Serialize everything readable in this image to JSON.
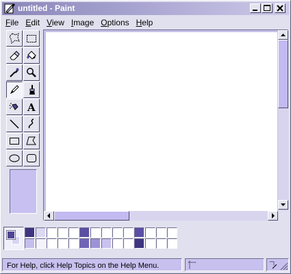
{
  "window": {
    "title": "untitled - Paint"
  },
  "menu": {
    "items": [
      {
        "label": "File",
        "key": "F",
        "rest": "ile"
      },
      {
        "label": "Edit",
        "key": "E",
        "rest": "dit"
      },
      {
        "label": "View",
        "key": "V",
        "rest": "iew"
      },
      {
        "label": "Image",
        "key": "I",
        "rest": "mage"
      },
      {
        "label": "Options",
        "key": "O",
        "rest": "ptions"
      },
      {
        "label": "Help",
        "key": "H",
        "rest": "elp"
      }
    ]
  },
  "tools": [
    "free-form-select",
    "select",
    "eraser",
    "fill-with-color",
    "pick-color",
    "magnifier",
    "pencil",
    "brush",
    "airbrush",
    "text",
    "line",
    "curve",
    "rectangle",
    "polygon",
    "ellipse",
    "rounded-rectangle"
  ],
  "active_tool": "pencil",
  "colors": {
    "foreground": "#4f4394",
    "background": "#d9d4f3",
    "palette_top": [
      "#3f3580",
      "#dcd8f2",
      "#ffffff",
      "#ffffff",
      "#ffffff",
      "#5a4fa4",
      "#ffffff",
      "#ffffff",
      "#ffffff",
      "#ffffff",
      "#5a4fa4",
      "#ffffff",
      "#ffffff",
      "#ffffff"
    ],
    "palette_bottom": [
      "#c5bdec",
      "#f4f2fb",
      "#ffffff",
      "#ffffff",
      "#ffffff",
      "#7064b8",
      "#9d92d6",
      "#c9c1ee",
      "#ffffff",
      "#ffffff",
      "#3f3580",
      "#ffffff",
      "#ffffff",
      "#ffffff"
    ]
  },
  "status": {
    "help_text": "For Help, click Help Topics on the Help Menu."
  }
}
